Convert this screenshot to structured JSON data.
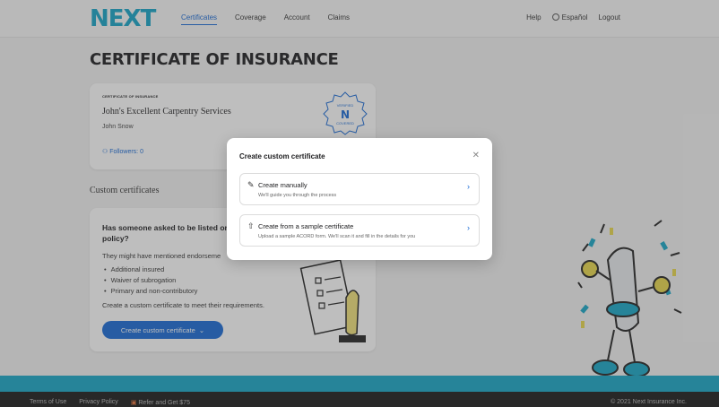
{
  "header": {
    "logo": "NEXT",
    "nav": [
      "Certificates",
      "Coverage",
      "Account",
      "Claims"
    ],
    "active_nav": "Certificates",
    "help": "Help",
    "language": "Español",
    "logout": "Logout"
  },
  "page": {
    "title": "CERTIFICATE OF INSURANCE"
  },
  "certificate": {
    "small_label": "CERTIFICATE OF INSURANCE",
    "company": "John's Excellent Carpentry Services",
    "person": "John Snow",
    "followers": "Followers: 0",
    "badge_top": "VERIFIED",
    "badge_letter": "N",
    "badge_bottom": "COVERED"
  },
  "custom_section": {
    "title": "Custom certificates",
    "heading": "Has someone asked to be listed on or policy?",
    "sub": "They might have mentioned endorseme",
    "bullets": [
      "Additional insured",
      "Waiver of subrogation",
      "Primary and non-contributory"
    ],
    "cta_text": "Create a custom certificate to meet their requirements.",
    "button": "Create custom certificate"
  },
  "modal": {
    "title": "Create custom certificate",
    "options": [
      {
        "title": "Create manually",
        "desc": "We'll guide you through the process",
        "icon": "edit-document-icon"
      },
      {
        "title": "Create from a sample certificate",
        "desc": "Upload a sample ACORD form. We'll scan it and fill in the details for you",
        "icon": "upload-icon"
      }
    ]
  },
  "footer": {
    "links": [
      "Terms of Use",
      "Privacy Policy",
      "Refer and Get $75"
    ],
    "copyright": "© 2021 Next Insurance Inc."
  },
  "colors": {
    "brand_teal": "#14a3c7",
    "primary_blue": "#1769d6",
    "footer_bg": "#1a1a1a"
  }
}
